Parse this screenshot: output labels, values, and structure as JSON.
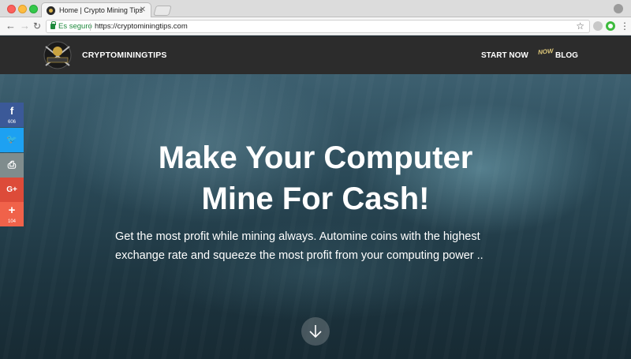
{
  "browser": {
    "tab_title": "Home | Crypto Mining Tips",
    "tab_close": "✕",
    "secure_label": "Es seguro",
    "url": "https://cryptominingtips.com"
  },
  "header": {
    "brand": "CRYPTOMININGTIPS",
    "nav_start": "START NOW",
    "nav_now": "NOW",
    "nav_blog": "BLOG"
  },
  "hero": {
    "title_line1": "Make Your Computer",
    "title_line2": "Mine For Cash!",
    "subtitle_line1": "Get the most profit while mining always. Automine coins with the highest",
    "subtitle_line2": "exchange rate and squeeze the most profit from your computing power .."
  },
  "share": {
    "facebook": {
      "glyph": "f",
      "count": "606",
      "color": "#3b5998"
    },
    "twitter": {
      "glyph": "🐦",
      "color": "#1da1f2"
    },
    "print": {
      "glyph": "⎙",
      "color": "#7f8c8d"
    },
    "googleplus": {
      "glyph": "G+",
      "color": "#dd4b39"
    },
    "more": {
      "glyph": "+",
      "count": "104",
      "color": "#f0624a"
    }
  }
}
